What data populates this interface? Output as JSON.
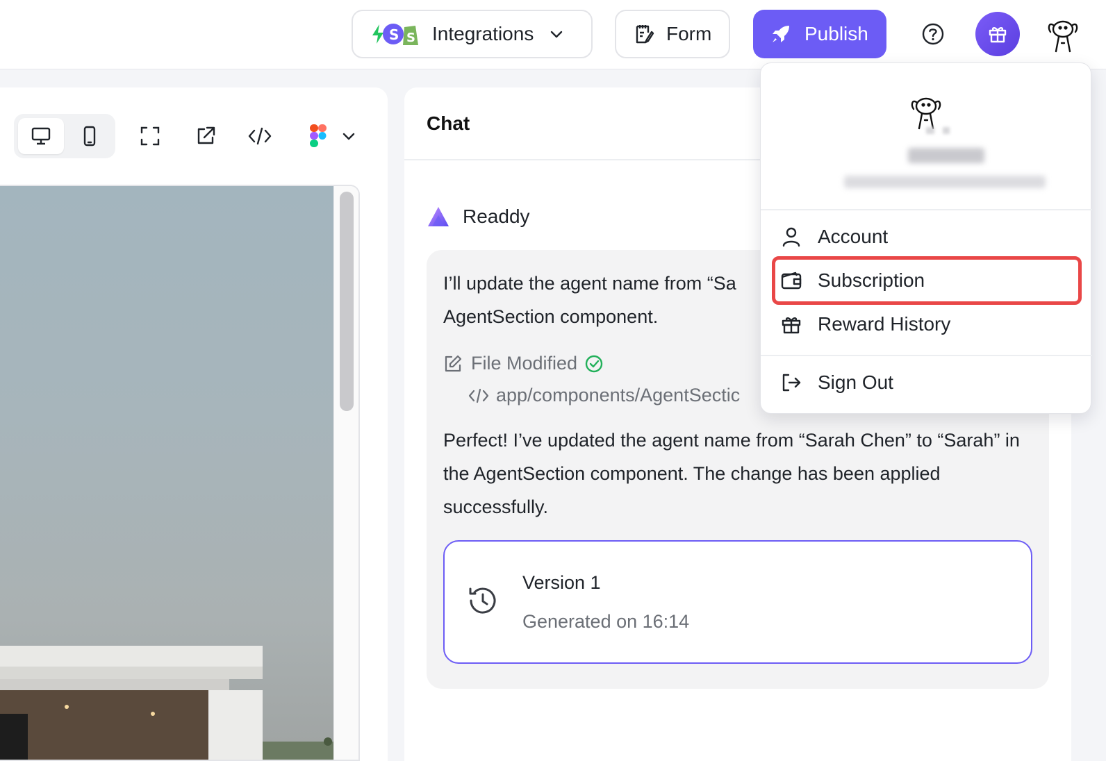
{
  "topbar": {
    "integrations_label": "Integrations",
    "form_label": "Form",
    "publish_label": "Publish"
  },
  "preview": {
    "tools": [
      "desktop-icon",
      "mobile-icon",
      "fullscreen-icon",
      "external-link-icon",
      "code-icon",
      "figma-icon",
      "chevron-down-icon"
    ]
  },
  "chat": {
    "title": "Chat",
    "agent_name": "Readdy",
    "message1": "I’ll update the agent name from “Sa",
    "message1_line2": "AgentSection component.",
    "file_status": "File Modified",
    "file_path": "app/components/AgentSectic",
    "message2": "Perfect! I’ve updated the agent name from “Sarah Chen” to “Sarah” in the AgentSection component. The change has been applied successfully.",
    "version_title": "Version 1",
    "version_sub": "Generated on 16:14"
  },
  "menu": {
    "account": "Account",
    "subscription": "Subscription",
    "reward_history": "Reward History",
    "sign_out": "Sign Out"
  },
  "colors": {
    "accent": "#6c5cf5",
    "highlight": "#e94747",
    "success": "#22b05a"
  }
}
